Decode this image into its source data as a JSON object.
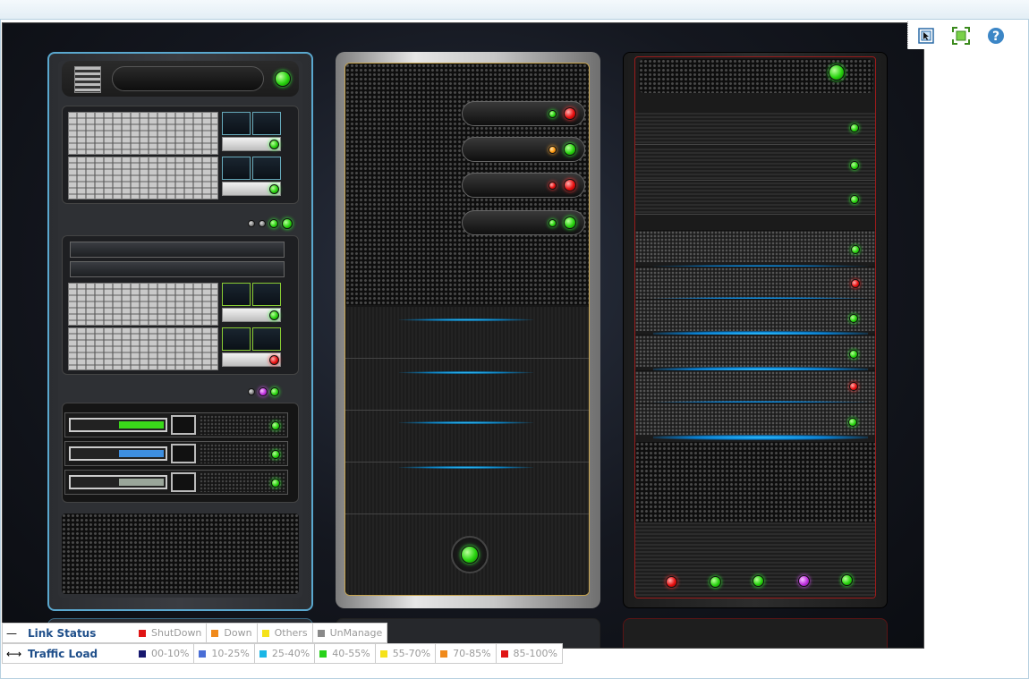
{
  "toolbar": {
    "items": [
      {
        "name": "select-mode-icon"
      },
      {
        "name": "fit-to-screen-icon"
      },
      {
        "name": "help-icon",
        "label": "?"
      }
    ]
  },
  "legend": {
    "link_status": {
      "label": "Link Status",
      "symbol": "—",
      "items": [
        {
          "label": "ShutDown",
          "color": "#e01515"
        },
        {
          "label": "Down",
          "color": "#f08a1c"
        },
        {
          "label": "Others",
          "color": "#f5e21a"
        },
        {
          "label": "UnManage",
          "color": "#8a8a8a"
        }
      ]
    },
    "traffic_load": {
      "label": "Traffic Load",
      "symbol": "⟷",
      "items": [
        {
          "label": "00-10%",
          "color": "#17186e"
        },
        {
          "label": "10-25%",
          "color": "#4a6ed6"
        },
        {
          "label": "25-40%",
          "color": "#1ab6e6"
        },
        {
          "label": "40-55%",
          "color": "#27d21a"
        },
        {
          "label": "55-70%",
          "color": "#f5e21a"
        },
        {
          "label": "70-85%",
          "color": "#f08a1c"
        },
        {
          "label": "85-100%",
          "color": "#e01515"
        }
      ]
    }
  },
  "colors": {
    "rack1_border": "#5aa8cf",
    "rack2_border": "#c6a34d",
    "rack3_border": "#9b1b1b",
    "status_green": "#28d40f",
    "status_red": "#e81010",
    "status_orange": "#ff9a10",
    "status_purple": "#c030e0",
    "glow_blue": "#36c6ff"
  }
}
